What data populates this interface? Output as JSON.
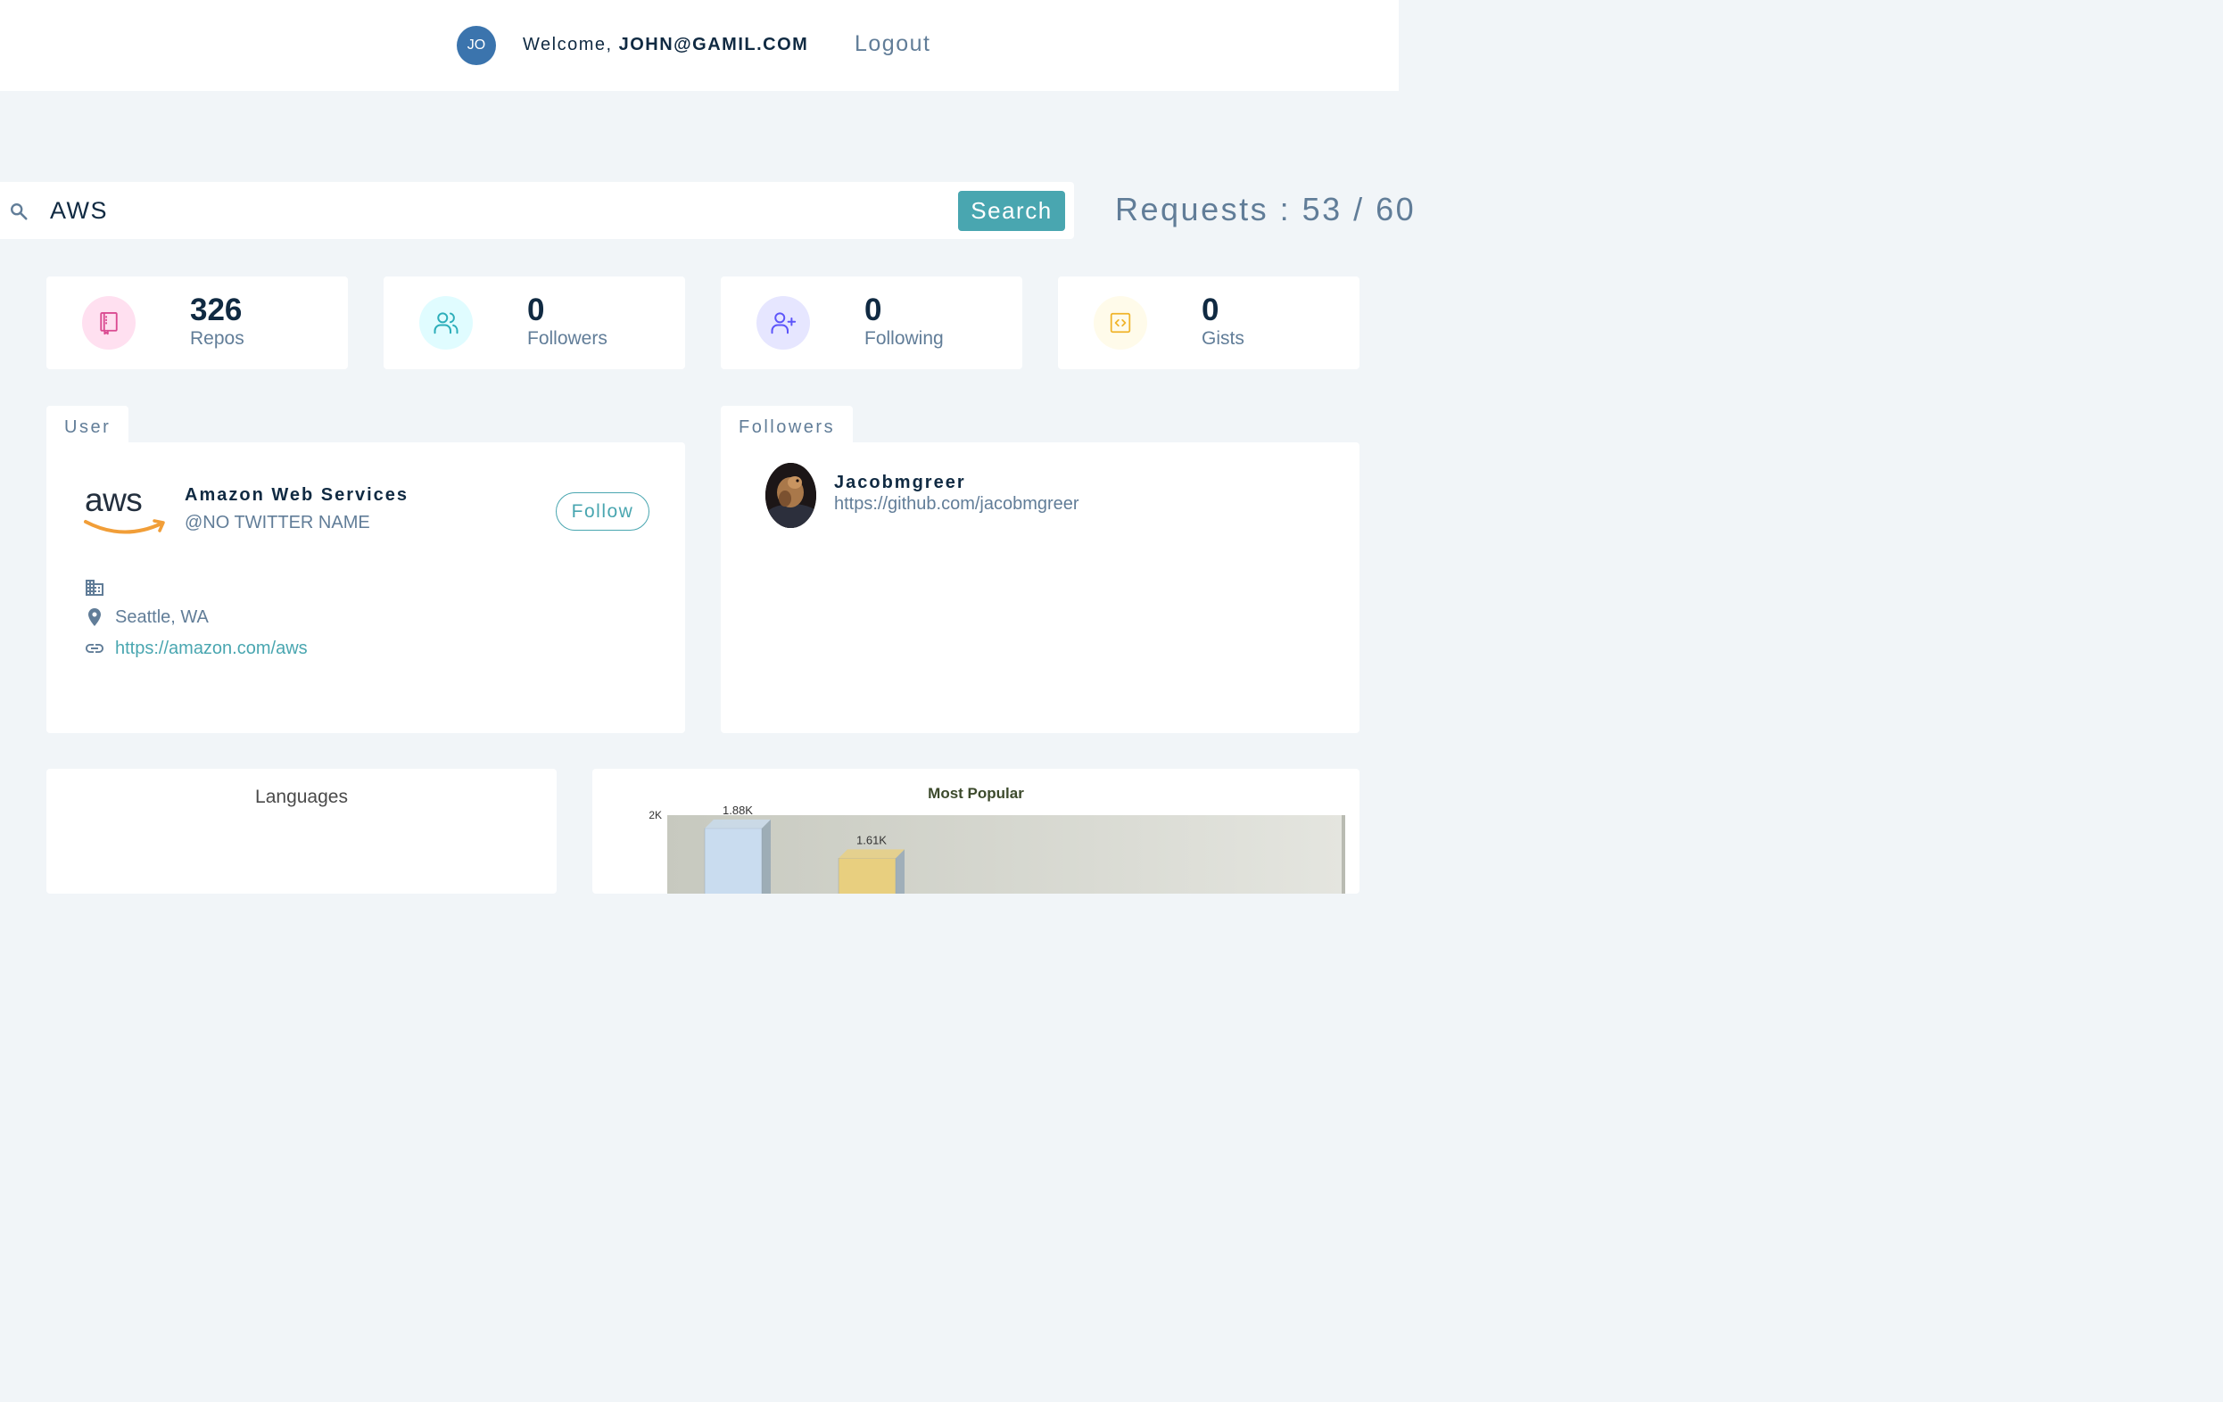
{
  "header": {
    "avatar_initials": "JO",
    "welcome_prefix": "Welcome,",
    "user_email": "JOHN@GAMIL.COM",
    "logout_label": "Logout"
  },
  "search": {
    "value": "AWS",
    "button_label": "Search",
    "requests_text": "Requests : 53 / 60"
  },
  "stats": [
    {
      "count": "326",
      "label": "Repos",
      "icon": "book-icon",
      "icon_color": "#da4a91",
      "icon_bg": "#ffe0f0"
    },
    {
      "count": "0",
      "label": "Followers",
      "icon": "users-icon",
      "icon_color": "#2caeba",
      "icon_bg": "#e0fcff"
    },
    {
      "count": "0",
      "label": "Following",
      "icon": "user-plus-icon",
      "icon_color": "#5d55fa",
      "icon_bg": "#e6e6ff"
    },
    {
      "count": "0",
      "label": "Gists",
      "icon": "code-icon",
      "icon_color": "#f0b429",
      "icon_bg": "#fffbea"
    }
  ],
  "user_panel": {
    "tab_label": "User",
    "name": "Amazon Web Services",
    "twitter": "@NO TWITTER NAME",
    "follow_label": "Follow",
    "company": "",
    "location": "Seattle, WA",
    "blog": "https://amazon.com/aws"
  },
  "followers_panel": {
    "tab_label": "Followers",
    "followers": [
      {
        "login": "Jacobmgreer",
        "url": "https://github.com/jacobmgreer"
      }
    ]
  },
  "languages_chart": {
    "title": "Languages"
  },
  "chart_data": {
    "type": "bar",
    "title": "Most Popular",
    "ylabel": "",
    "ytick_labels": [
      "2K"
    ],
    "ylim": [
      0,
      2000
    ],
    "values": [
      1880,
      1610
    ],
    "value_labels": [
      "1.88K",
      "1.61K"
    ],
    "series_colors": [
      "#c9dcef",
      "#e8cf7f"
    ]
  },
  "colors": {
    "primary": "#49a6b0",
    "avatar": "#3b74ad",
    "text_dark": "#102a42",
    "text_muted": "#617d98",
    "background": "#f1f5f8"
  }
}
